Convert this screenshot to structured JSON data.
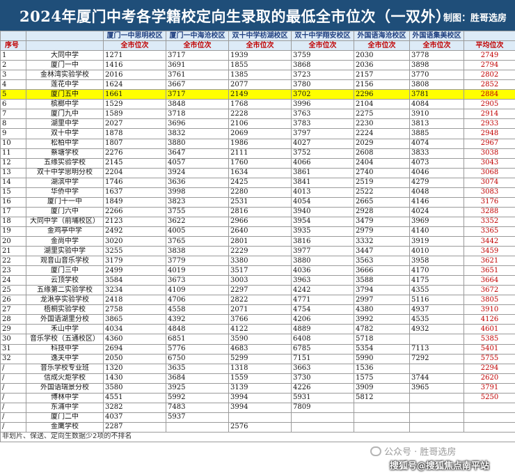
{
  "title": "2024年厦门中考各学籍校定向生录取的最低全市位次（一双外）",
  "credit": "制图：胜哥选房",
  "header": {
    "index": "序号",
    "campuses": [
      "厦门一中思明校区",
      "厦门一中海沧校区",
      "双十中学枋湖校区",
      "双十中学翔安校区",
      "外国语海沧校区",
      "外国语集美校区"
    ],
    "rank_label": "全市位次",
    "avg_label": "平均位次"
  },
  "rows": [
    {
      "idx": "1",
      "name": "大同中学",
      "v": [
        "1271",
        "3717",
        "1939",
        "3759",
        "2030",
        "3778"
      ],
      "avg": "2749"
    },
    {
      "idx": "2",
      "name": "厦门一中",
      "v": [
        "1416",
        "3691",
        "1855",
        "3868",
        "2036",
        "3898"
      ],
      "avg": "2794"
    },
    {
      "idx": "3",
      "name": "金林湾实验学校",
      "v": [
        "2016",
        "3761",
        "1385",
        "3723",
        "2157",
        "3770"
      ],
      "avg": "2802"
    },
    {
      "idx": "4",
      "name": "莲花中学",
      "v": [
        "1624",
        "3667",
        "2077",
        "3780",
        "2156",
        "3808"
      ],
      "avg": "2852"
    },
    {
      "idx": "5",
      "name": "厦门五中",
      "v": [
        "1661",
        "3717",
        "2149",
        "3702",
        "2296",
        "3781"
      ],
      "avg": "2884",
      "highlight": true
    },
    {
      "idx": "6",
      "name": "槟榔中学",
      "v": [
        "1529",
        "3848",
        "1768",
        "3996",
        "2104",
        "4084"
      ],
      "avg": "2905"
    },
    {
      "idx": "7",
      "name": "厦门九中",
      "v": [
        "1589",
        "3718",
        "2228",
        "3763",
        "2275",
        "3910"
      ],
      "avg": "2914"
    },
    {
      "idx": "8",
      "name": "湖里中学",
      "v": [
        "2027",
        "3696",
        "2106",
        "3783",
        "2230",
        "3813"
      ],
      "avg": "2933"
    },
    {
      "idx": "9",
      "name": "双十中学",
      "v": [
        "1878",
        "3832",
        "2069",
        "3797",
        "2224",
        "3885"
      ],
      "avg": "2948"
    },
    {
      "idx": "10",
      "name": "松柏中学",
      "v": [
        "1807",
        "3880",
        "1986",
        "4027",
        "2029",
        "4074"
      ],
      "avg": "2967"
    },
    {
      "idx": "11",
      "name": "蔡塘学校",
      "v": [
        "2276",
        "3647",
        "2111",
        "3752",
        "2608",
        "3833"
      ],
      "avg": "3038"
    },
    {
      "idx": "12",
      "name": "五缘实验学校",
      "v": [
        "2145",
        "4057",
        "1760",
        "4066",
        "2404",
        "4073"
      ],
      "avg": "3043"
    },
    {
      "idx": "13",
      "name": "双十中学思明分校",
      "v": [
        "2204",
        "3924",
        "1634",
        "3861",
        "2740",
        "4046"
      ],
      "avg": "3068"
    },
    {
      "idx": "14",
      "name": "湖滨中学",
      "v": [
        "1746",
        "3636",
        "2425",
        "3841",
        "2519",
        "4279"
      ],
      "avg": "3074"
    },
    {
      "idx": "15",
      "name": "华侨中学",
      "v": [
        "1637",
        "3998",
        "2280",
        "4013",
        "2522",
        "4048"
      ],
      "avg": "3083"
    },
    {
      "idx": "16",
      "name": "厦门十一中",
      "v": [
        "1849",
        "3823",
        "2531",
        "4054",
        "2665",
        "4146"
      ],
      "avg": "3176"
    },
    {
      "idx": "17",
      "name": "厦门六中",
      "v": [
        "2266",
        "3755",
        "2816",
        "3940",
        "2928",
        "4024"
      ],
      "avg": "3288"
    },
    {
      "idx": "18",
      "name": "大同中学（前埔校区）",
      "v": [
        "2123",
        "3622",
        "2966",
        "3954",
        "3479",
        "3969"
      ],
      "avg": "3352"
    },
    {
      "idx": "19",
      "name": "金鸡亭中学",
      "v": [
        "2492",
        "4005",
        "2640",
        "3935",
        "2979",
        "4140"
      ],
      "avg": "3365"
    },
    {
      "idx": "20",
      "name": "金尚中学",
      "v": [
        "3020",
        "3765",
        "2801",
        "3816",
        "3332",
        "3919"
      ],
      "avg": "3442"
    },
    {
      "idx": "21",
      "name": "湖里实验中学",
      "v": [
        "3255",
        "3838",
        "2229",
        "3977",
        "3447",
        "4010"
      ],
      "avg": "3459"
    },
    {
      "idx": "22",
      "name": "观音山音乐学校",
      "v": [
        "3179",
        "3779",
        "3380",
        "3880",
        "3563",
        "3958"
      ],
      "avg": "3621"
    },
    {
      "idx": "23",
      "name": "厦门三中",
      "v": [
        "2499",
        "4019",
        "3517",
        "4036",
        "3666",
        "4170"
      ],
      "avg": "3651"
    },
    {
      "idx": "24",
      "name": "云顶学校",
      "v": [
        "3584",
        "3673",
        "3003",
        "3963",
        "3588",
        "4175"
      ],
      "avg": "3664"
    },
    {
      "idx": "25",
      "name": "五缘第二实验学校",
      "v": [
        "3234",
        "4109",
        "2297",
        "4242",
        "3794",
        "4355"
      ],
      "avg": "3672"
    },
    {
      "idx": "26",
      "name": "龙湫亭实验学校",
      "v": [
        "2418",
        "4706",
        "2822",
        "4771",
        "2997",
        "5116"
      ],
      "avg": "3805"
    },
    {
      "idx": "27",
      "name": "梧桐实验学校",
      "v": [
        "2758",
        "4558",
        "2071",
        "4754",
        "4380",
        "4937"
      ],
      "avg": "3910"
    },
    {
      "idx": "28",
      "name": "外国语湖里分校",
      "v": [
        "3865",
        "4392",
        "3766",
        "4206",
        "3992",
        "4535"
      ],
      "avg": "4126"
    },
    {
      "idx": "29",
      "name": "禾山中学",
      "v": [
        "4034",
        "4848",
        "4122",
        "4889",
        "4782",
        "4932"
      ],
      "avg": "4601"
    },
    {
      "idx": "30",
      "name": "音乐学校（五通校区）",
      "v": [
        "4360",
        "6851",
        "3590",
        "6408",
        "5718",
        ""
      ],
      "avg": "5385"
    },
    {
      "idx": "31",
      "name": "科技中学",
      "v": [
        "2694",
        "5776",
        "4683",
        "6785",
        "5354",
        "7113"
      ],
      "avg": "5401"
    },
    {
      "idx": "32",
      "name": "逸夫中学",
      "v": [
        "2050",
        "6750",
        "5299",
        "7151",
        "5990",
        "7292"
      ],
      "avg": "5755"
    },
    {
      "idx": "/",
      "name": "音乐学校专业班",
      "v": [
        "1320",
        "3635",
        "1318",
        "3663",
        "1536",
        ""
      ],
      "avg": "2294"
    },
    {
      "idx": "/",
      "name": "信成火炬学校",
      "v": [
        "1430",
        "3684",
        "1559",
        "3730",
        "1575",
        "3744"
      ],
      "avg": "2620"
    },
    {
      "idx": "/",
      "name": "外国语瑞景分校",
      "v": [
        "3580",
        "3925",
        "3139",
        "4226",
        "3909",
        "3965"
      ],
      "avg": "3791"
    },
    {
      "idx": "/",
      "name": "博林中学",
      "v": [
        "4551",
        "5992",
        "3994",
        "5931",
        "5812",
        ""
      ],
      "avg": "5250"
    },
    {
      "idx": "/",
      "name": "东浦中学",
      "v": [
        "3282",
        "7483",
        "3994",
        "7809",
        "",
        ""
      ],
      "avg": ""
    },
    {
      "idx": "/",
      "name": "厦门二中",
      "v": [
        "4037",
        "5937",
        "",
        "",
        "",
        ""
      ],
      "avg": ""
    },
    {
      "idx": "/",
      "name": "金鹰学校",
      "v": [
        "2287",
        "",
        "2576",
        "",
        "",
        ""
      ],
      "avg": ""
    }
  ],
  "footnote": "非划片、保送、定向生数据少2项的不排名",
  "watermark_1": "公众号 · 胜哥选房",
  "watermark_2": "搜狐号@搜狐焦点南平站",
  "colors": {
    "title_bg": "#1f4e79",
    "header_bg": "#ddebf7",
    "header_text": "#1f3f7f",
    "accent_red": "#c00000",
    "highlight": "#ffff00"
  }
}
